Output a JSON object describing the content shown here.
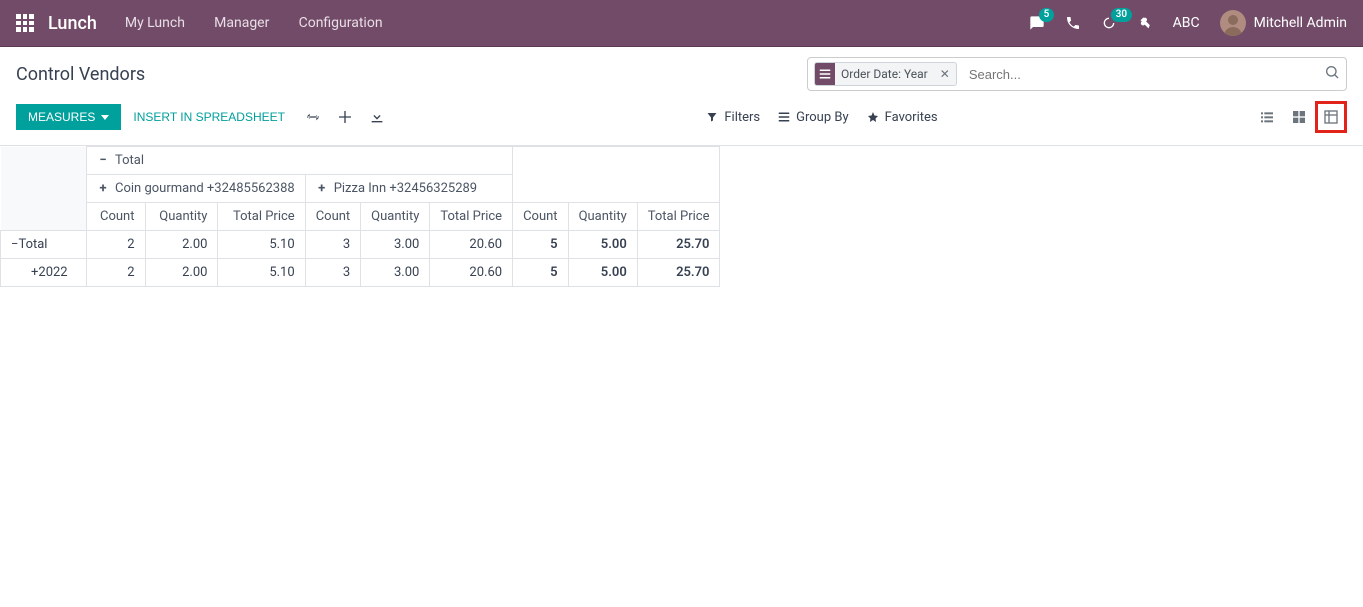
{
  "topbar": {
    "appname": "Lunch",
    "menu": [
      "My Lunch",
      "Manager",
      "Configuration"
    ],
    "messages_badge": "5",
    "timer_badge": "30",
    "company": "ABC",
    "user": "Mitchell Admin"
  },
  "page": {
    "title": "Control Vendors",
    "search_facet": "Order Date: Year",
    "search_placeholder": "Search...",
    "measures_btn": "MEASURES",
    "spreadsheet_btn": "INSERT IN SPREADSHEET",
    "filters_label": "Filters",
    "groupby_label": "Group By",
    "favorites_label": "Favorites"
  },
  "pivot": {
    "total_label": "Total",
    "vendors": [
      "Coin gourmand +32485562388",
      "Pizza Inn +32456325289"
    ],
    "measure_cols": [
      "Count",
      "Quantity",
      "Total Price"
    ],
    "rows": [
      {
        "label": "Total",
        "expanded": true,
        "indent": false,
        "bold": true,
        "values": [
          "2",
          "2.00",
          "5.10",
          "3",
          "3.00",
          "20.60",
          "5",
          "5.00",
          "25.70"
        ]
      },
      {
        "label": "2022",
        "expanded": false,
        "indent": true,
        "bold": false,
        "values": [
          "2",
          "2.00",
          "5.10",
          "3",
          "3.00",
          "20.60",
          "5",
          "5.00",
          "25.70"
        ]
      }
    ]
  }
}
